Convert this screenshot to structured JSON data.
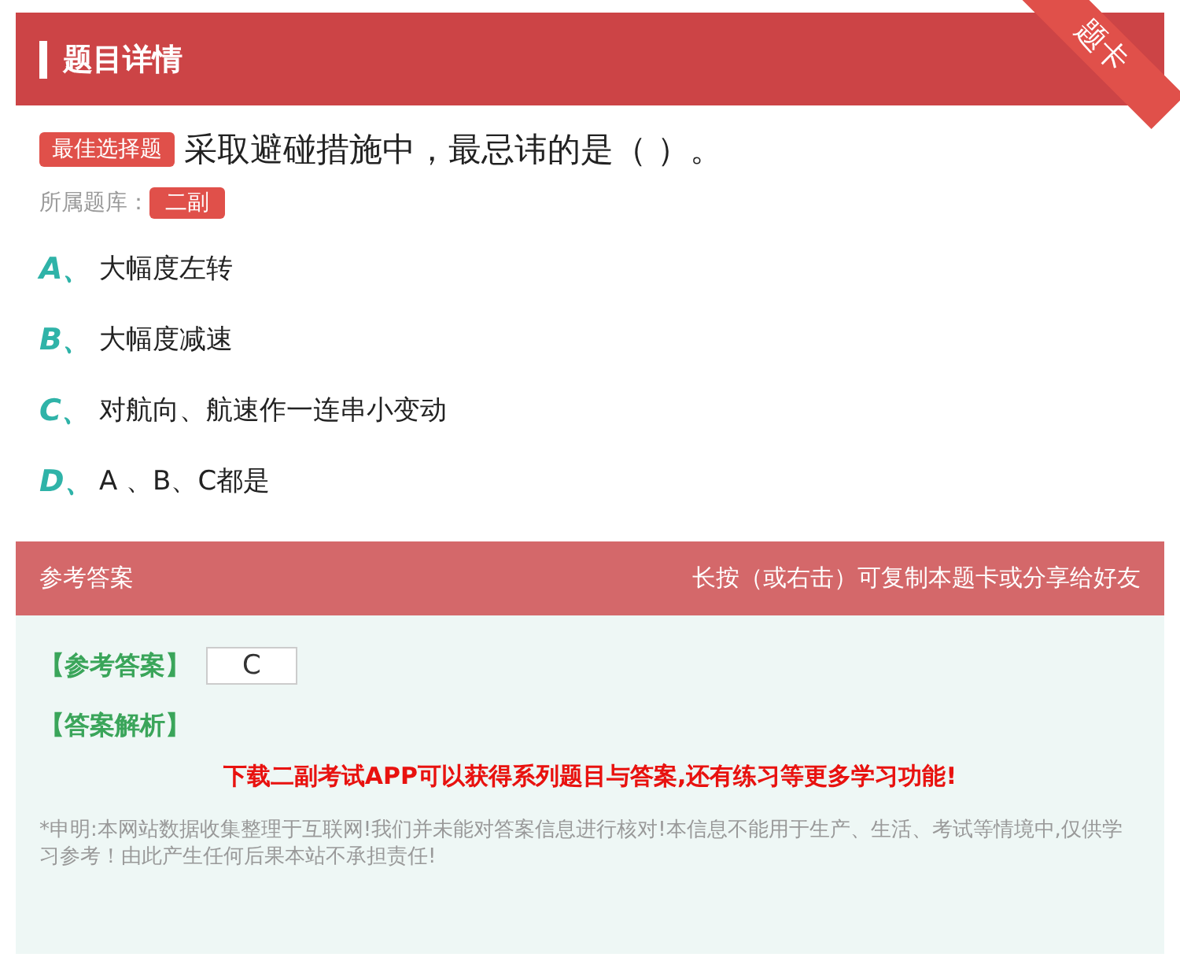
{
  "header": {
    "title": "题目详情",
    "ribbon": "题卡"
  },
  "question": {
    "type_tag": "最佳选择题",
    "text": "采取避碰措施中，最忌讳的是（   ）。",
    "bank_label": "所属题库：",
    "bank_tag": "二副"
  },
  "options": [
    {
      "letter": "A、",
      "text": "大幅度左转"
    },
    {
      "letter": "B、",
      "text": "大幅度减速"
    },
    {
      "letter": "C、",
      "text": "对航向、航速作一连串小变动"
    },
    {
      "letter": "D、",
      "text": "A 、B、C都是"
    }
  ],
  "answer_bar": {
    "title": "参考答案",
    "hint": "长按（或右击）可复制本题卡或分享给好友"
  },
  "answer": {
    "label": "【参考答案】",
    "value": "C",
    "analysis_label": "【答案解析】",
    "promo": "下载二副考试APP可以获得系列题目与答案,还有练习等更多学习功能!",
    "disclaimer": "*申明:本网站数据收集整理于互联网!我们并未能对答案信息进行核对!本信息不能用于生产、生活、考试等情境中,仅供学习参考！由此产生任何后果本站不承担责任!"
  }
}
